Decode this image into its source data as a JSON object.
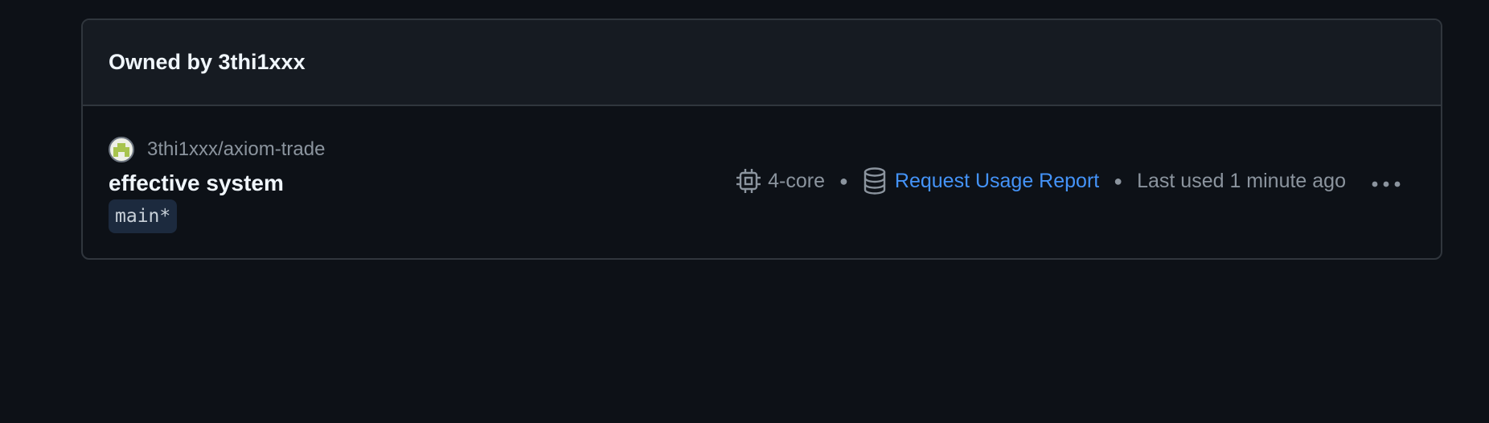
{
  "owner_section": {
    "title": "Owned by 3thi1xxx"
  },
  "codespace": {
    "repository": "3thi1xxx/axiom-trade",
    "name": "effective system",
    "branch": "main*",
    "machine": "4-core",
    "usage_link": "Request Usage Report",
    "last_used": "Last used 1 minute ago",
    "icons": {
      "avatar": "identicon-avatar",
      "machine": "cpu-icon",
      "storage": "database-icon",
      "more": "kebab-horizontal-icon"
    }
  },
  "colors": {
    "background": "#0d1117",
    "header_bg": "#161b22",
    "border": "#30363d",
    "link": "#4493f8",
    "muted_text": "#8b949e",
    "primary_text": "#f0f6fc",
    "branch_bg": "#1c2a3e"
  }
}
